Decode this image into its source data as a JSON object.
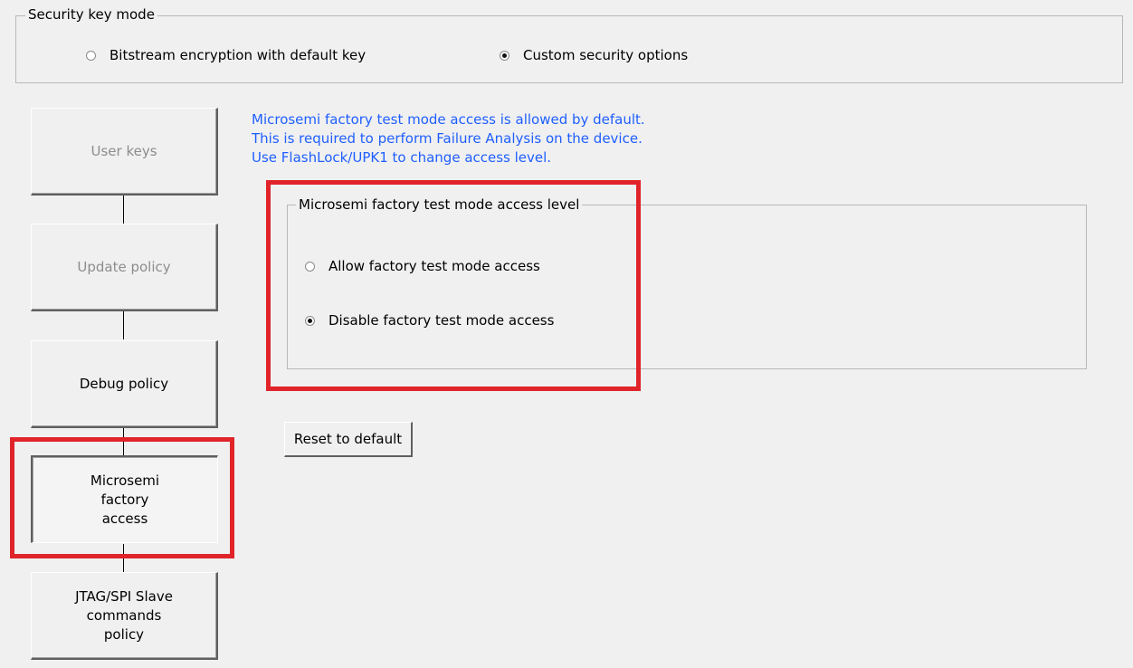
{
  "security_key_mode": {
    "legend": "Security key mode",
    "options": [
      {
        "label": "Bitstream encryption with default key",
        "checked": false
      },
      {
        "label": "Custom security options",
        "checked": true
      }
    ]
  },
  "sidebar": {
    "items": [
      {
        "label": "User keys",
        "state": "disabled"
      },
      {
        "label": "Update policy",
        "state": "disabled"
      },
      {
        "label": "Debug policy",
        "state": "enabled"
      },
      {
        "label": "Microsemi\nfactory\naccess",
        "state": "selected"
      },
      {
        "label": "JTAG/SPI Slave\ncommands\npolicy",
        "state": "enabled"
      }
    ]
  },
  "info": {
    "lines": [
      "Microsemi factory test mode access is allowed by default.",
      "This is required to perform Failure Analysis on the device.",
      "Use FlashLock/UPK1 to change access level."
    ],
    "color": "#1f5fff"
  },
  "access_level": {
    "legend": "Microsemi factory test mode access level",
    "options": [
      {
        "label": "Allow factory test mode access",
        "checked": false
      },
      {
        "label": "Disable factory test mode access",
        "checked": true
      }
    ]
  },
  "reset_button": {
    "label": "Reset to default"
  },
  "annotation": {
    "highlight_color": "#e0242a"
  }
}
